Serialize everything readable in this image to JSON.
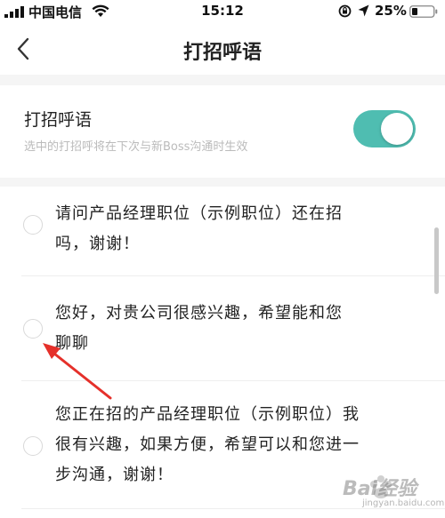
{
  "status_bar": {
    "carrier": "中国电信",
    "time": "15:12",
    "battery": "25%"
  },
  "nav": {
    "title": "打招呼语"
  },
  "toggle": {
    "label": "打招呼语",
    "description": "选中的打招呼将在下次与新Boss沟通时生效",
    "enabled": true,
    "accent_color": "#4fbdb1"
  },
  "greetings": [
    {
      "lines": [
        "请问产品经理职位（示例职位）还在招",
        "吗，谢谢！"
      ],
      "selected": false
    },
    {
      "lines": [
        "您好，对贵公司很感兴趣，希望能和您",
        "聊聊"
      ],
      "selected": false
    },
    {
      "lines": [
        "您正在招的产品经理职位（示例职位）我",
        "很有兴趣，如果方便，希望可以和您进一",
        "步沟通，谢谢！"
      ],
      "selected": false
    }
  ],
  "watermark": {
    "text": "Bai经验",
    "sub": "jingyan.baidu.com"
  },
  "icons": {
    "back": "chevron-left-icon",
    "signal": "signal-icon",
    "wifi": "wifi-icon",
    "lock": "rotation-lock-icon",
    "location": "location-icon",
    "battery": "battery-icon"
  }
}
